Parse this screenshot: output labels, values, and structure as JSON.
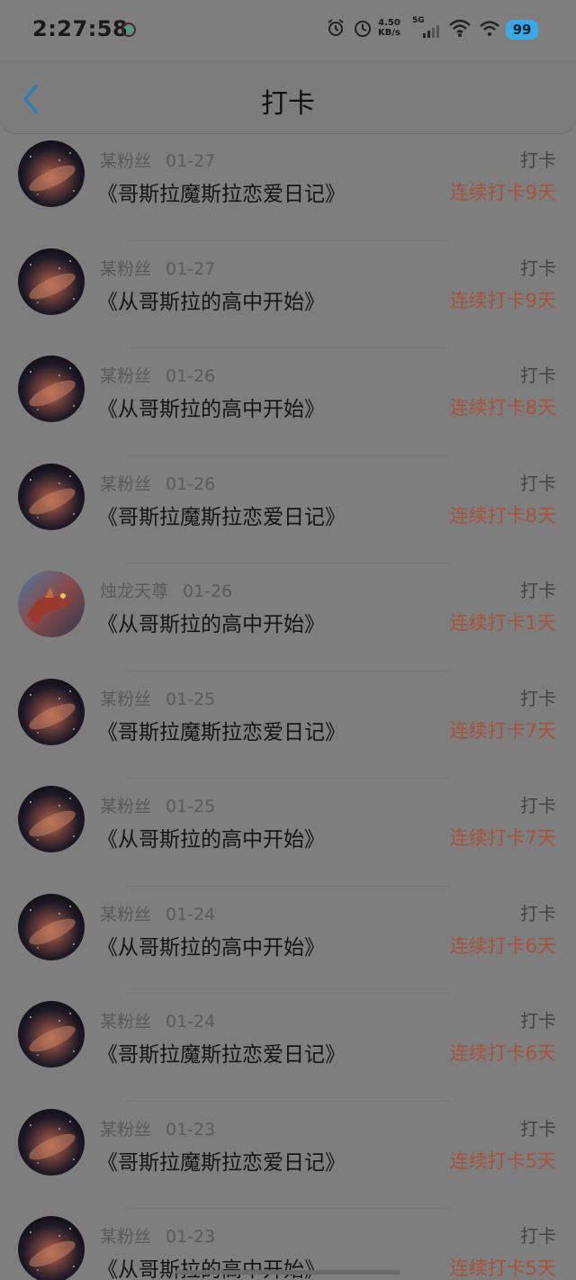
{
  "status_bar": {
    "time": "2:27:58",
    "net_speed_value": "4.50",
    "net_speed_unit": "KB/s",
    "network_type": "5G",
    "battery": "99"
  },
  "header": {
    "title": "打卡",
    "back_icon": "chevron-left-icon"
  },
  "rows": [
    {
      "user": "某粉丝",
      "date": "01-27",
      "book": "《哥斯拉魔斯拉恋爱日记》",
      "action": "打卡",
      "streak": "连续打卡9天",
      "avatar": "galaxy"
    },
    {
      "user": "某粉丝",
      "date": "01-27",
      "book": "《从哥斯拉的高中开始》",
      "action": "打卡",
      "streak": "连续打卡9天",
      "avatar": "galaxy"
    },
    {
      "user": "某粉丝",
      "date": "01-26",
      "book": "《从哥斯拉的高中开始》",
      "action": "打卡",
      "streak": "连续打卡8天",
      "avatar": "galaxy"
    },
    {
      "user": "某粉丝",
      "date": "01-26",
      "book": "《哥斯拉魔斯拉恋爱日记》",
      "action": "打卡",
      "streak": "连续打卡8天",
      "avatar": "galaxy"
    },
    {
      "user": "烛龙天尊",
      "date": "01-26",
      "book": "《从哥斯拉的高中开始》",
      "action": "打卡",
      "streak": "连续打卡1天",
      "avatar": "dragon"
    },
    {
      "user": "某粉丝",
      "date": "01-25",
      "book": "《哥斯拉魔斯拉恋爱日记》",
      "action": "打卡",
      "streak": "连续打卡7天",
      "avatar": "galaxy"
    },
    {
      "user": "某粉丝",
      "date": "01-25",
      "book": "《从哥斯拉的高中开始》",
      "action": "打卡",
      "streak": "连续打卡7天",
      "avatar": "galaxy"
    },
    {
      "user": "某粉丝",
      "date": "01-24",
      "book": "《从哥斯拉的高中开始》",
      "action": "打卡",
      "streak": "连续打卡6天",
      "avatar": "galaxy"
    },
    {
      "user": "某粉丝",
      "date": "01-24",
      "book": "《哥斯拉魔斯拉恋爱日记》",
      "action": "打卡",
      "streak": "连续打卡6天",
      "avatar": "galaxy"
    },
    {
      "user": "某粉丝",
      "date": "01-23",
      "book": "《哥斯拉魔斯拉恋爱日记》",
      "action": "打卡",
      "streak": "连续打卡5天",
      "avatar": "galaxy"
    },
    {
      "user": "某粉丝",
      "date": "01-23",
      "book": "《从哥斯拉的高中开始》",
      "action": "打卡",
      "streak": "连续打卡5天",
      "avatar": "galaxy"
    }
  ],
  "colors": {
    "streak": "#a6533a",
    "back_icon": "#2f7db3"
  }
}
